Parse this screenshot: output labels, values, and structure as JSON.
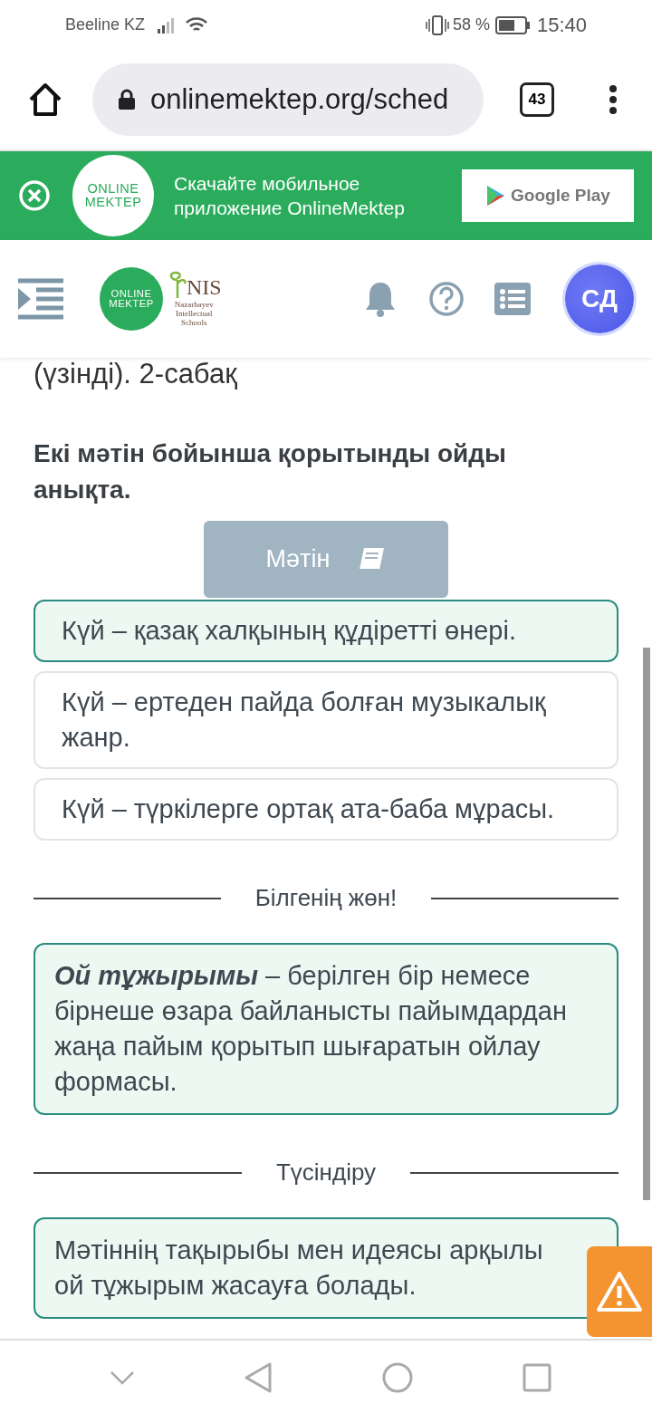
{
  "status_bar": {
    "carrier": "Beeline KZ",
    "battery": "58 %",
    "time": "15:40"
  },
  "browser": {
    "url": "onlinemektep.org/sched",
    "tabs_count": "43"
  },
  "banner": {
    "logo": [
      "ONLINE",
      "MEKTEP"
    ],
    "text": "Скачайте мобильное приложение OnlineMektep",
    "store": "Google Play"
  },
  "header": {
    "logo": [
      "ONLINE",
      "MEKTEP"
    ],
    "partner": "NIS",
    "partner_sub": "Nazarbayev Intellectual Schools",
    "avatar": "СД"
  },
  "lesson_title": "(үзінді). 2-сабақ",
  "question": "Екі мәтін бойынша қорытынды ойды анықта.",
  "text_button": "Мәтін",
  "options": [
    {
      "text": "Күй – қазақ халқының құдіретті өнері.",
      "selected": true
    },
    {
      "text": "Күй – ертеден пайда болған музыкалық жанр.",
      "selected": false
    },
    {
      "text": "Күй – түркілерге ортақ ата-баба мұрасы.",
      "selected": false
    }
  ],
  "sections": [
    {
      "heading": "Білгенің жөн!",
      "body": "**Ой тұжырымы** – берілген бір немесе бірнеше өзара байланысты пайымдардан жаңа пайым қорытып шығаратын ойлау формасы."
    },
    {
      "heading": "Түсіндіру",
      "body": "Мәтіннің тақырыбы мен идеясы арқылы ой тұжырым жасауға болады."
    }
  ]
}
